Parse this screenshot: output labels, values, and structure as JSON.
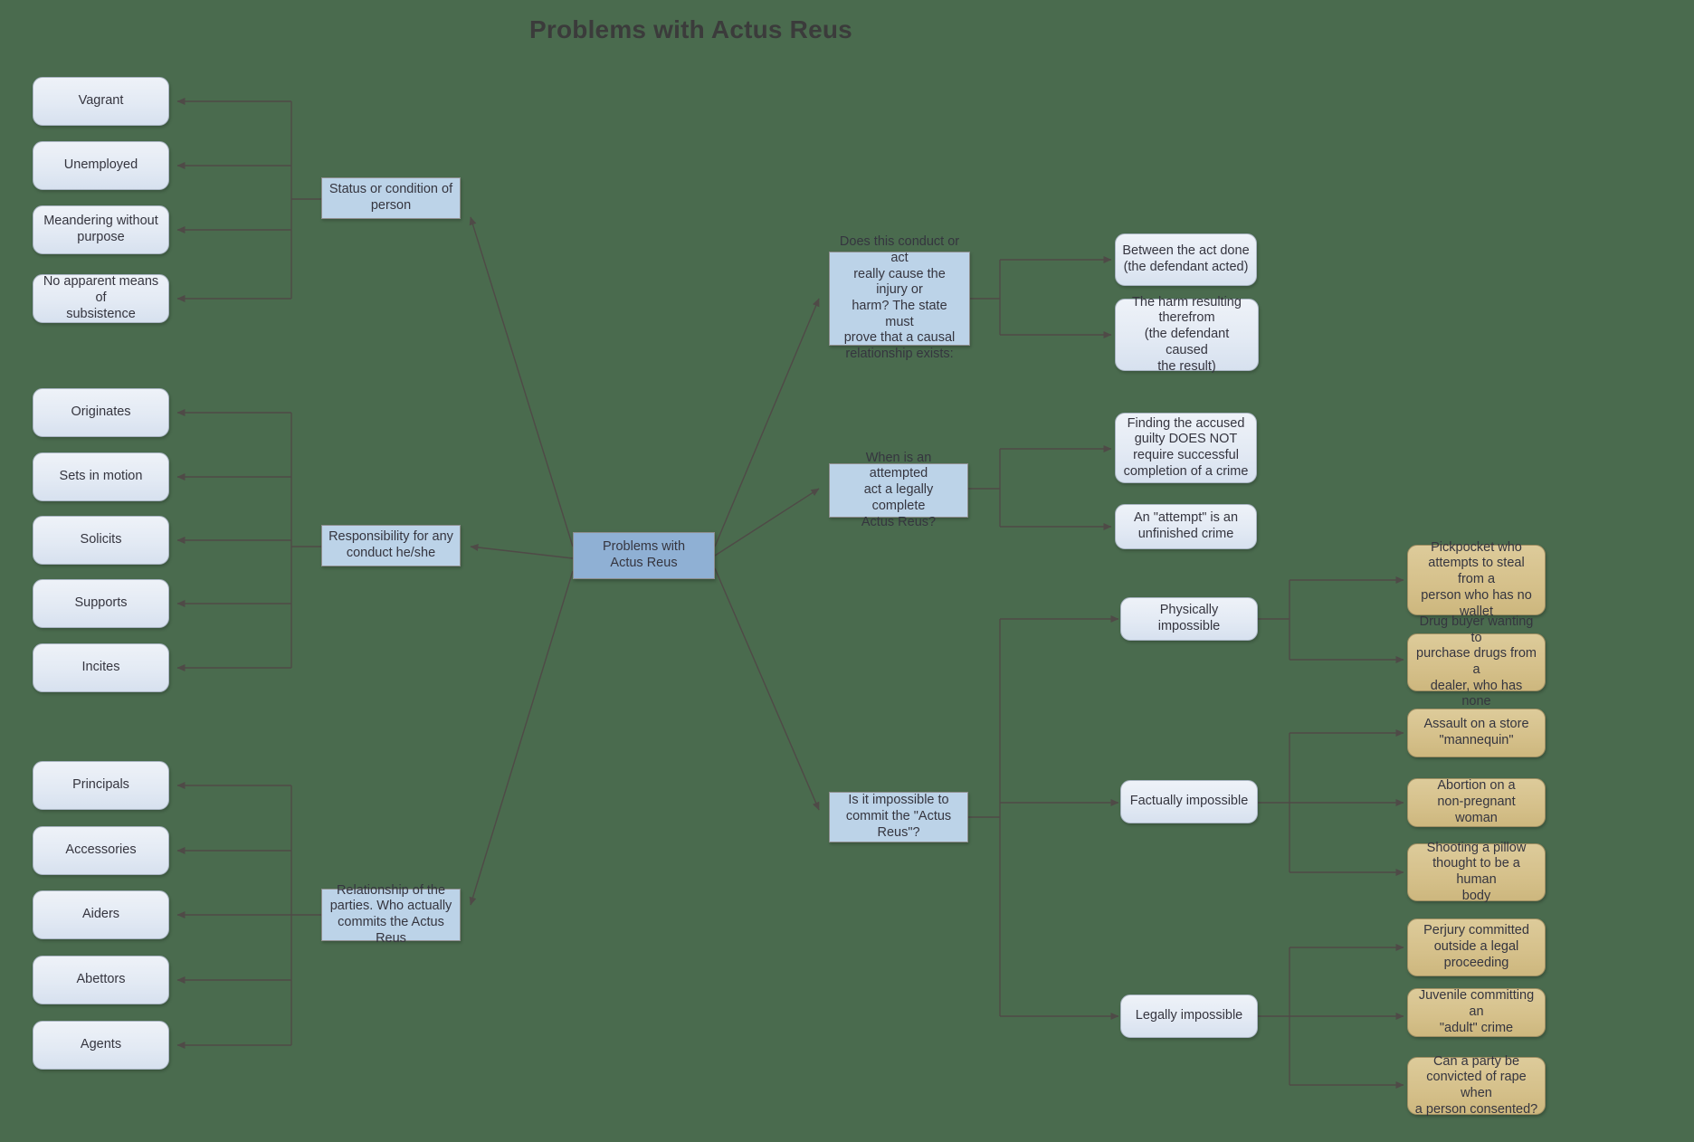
{
  "title": "Problems with Actus Reus",
  "theme": {
    "background": "#4a6b4e",
    "title_color": "#3b3b3b",
    "leaf_fill": "#e3eaf4",
    "topic_fill": "#bcd3e8",
    "center_fill": "#8fb0d4",
    "example_fill": "#d5c08a",
    "edge_color": "#4f4a47"
  },
  "center": {
    "label": "Problems with\nActus Reus"
  },
  "branches": [
    {
      "id": "status",
      "label": "Status or condition of\nperson",
      "children": [
        {
          "label": "Vagrant"
        },
        {
          "label": "Unemployed"
        },
        {
          "label": "Meandering without\npurpose"
        },
        {
          "label": "No apparent means of\nsubsistence"
        }
      ]
    },
    {
      "id": "responsibility",
      "label": "Responsibility for any\nconduct he/she",
      "children": [
        {
          "label": "Originates"
        },
        {
          "label": "Sets in motion"
        },
        {
          "label": "Solicits"
        },
        {
          "label": "Supports"
        },
        {
          "label": "Incites"
        }
      ]
    },
    {
      "id": "relationship",
      "label": "Relationship of the\nparties.  Who actually\ncommits the Actus Reus",
      "children": [
        {
          "label": "Principals"
        },
        {
          "label": "Accessories"
        },
        {
          "label": "Aiders"
        },
        {
          "label": "Abettors"
        },
        {
          "label": "Agents"
        }
      ]
    },
    {
      "id": "causation",
      "label": "Does this conduct or act\nreally cause the injury or\nharm? The state must\nprove that a causal\nrelationship exists:",
      "children": [
        {
          "label": "Between the act done\n(the defendant acted)"
        },
        {
          "label": "The harm resulting\ntherefrom\n(the defendant caused\nthe result)"
        }
      ]
    },
    {
      "id": "attempt",
      "label": "When is an attempted\nact a legally complete\nActus Reus?",
      "children": [
        {
          "label": "Finding the accused\nguilty DOES NOT\nrequire successful\ncompletion of a crime"
        },
        {
          "label": "An \"attempt\" is an\nunfinished crime"
        }
      ]
    },
    {
      "id": "impossible",
      "label": "Is it impossible to\ncommit the \"Actus\nReus\"?",
      "children": [
        {
          "label": "Physically impossible",
          "examples": [
            {
              "label": "Pickpocket who\nattempts to steal from a\nperson who has no\nwallet"
            },
            {
              "label": "Drug buyer wanting to\npurchase drugs from a\ndealer, who has none"
            }
          ]
        },
        {
          "label": "Factually impossible",
          "examples": [
            {
              "label": "Assault on a store\n\"mannequin\""
            },
            {
              "label": "Abortion on a\nnon-pregnant woman"
            },
            {
              "label": "Shooting a pillow\nthought to be a human\nbody"
            }
          ]
        },
        {
          "label": "Legally impossible",
          "examples": [
            {
              "label": "Perjury committed\noutside a legal\nproceeding"
            },
            {
              "label": "Juvenile committing an\n\"adult\" crime"
            },
            {
              "label": "Can a party be\nconvicted of rape when\na person consented?"
            }
          ]
        }
      ]
    }
  ]
}
